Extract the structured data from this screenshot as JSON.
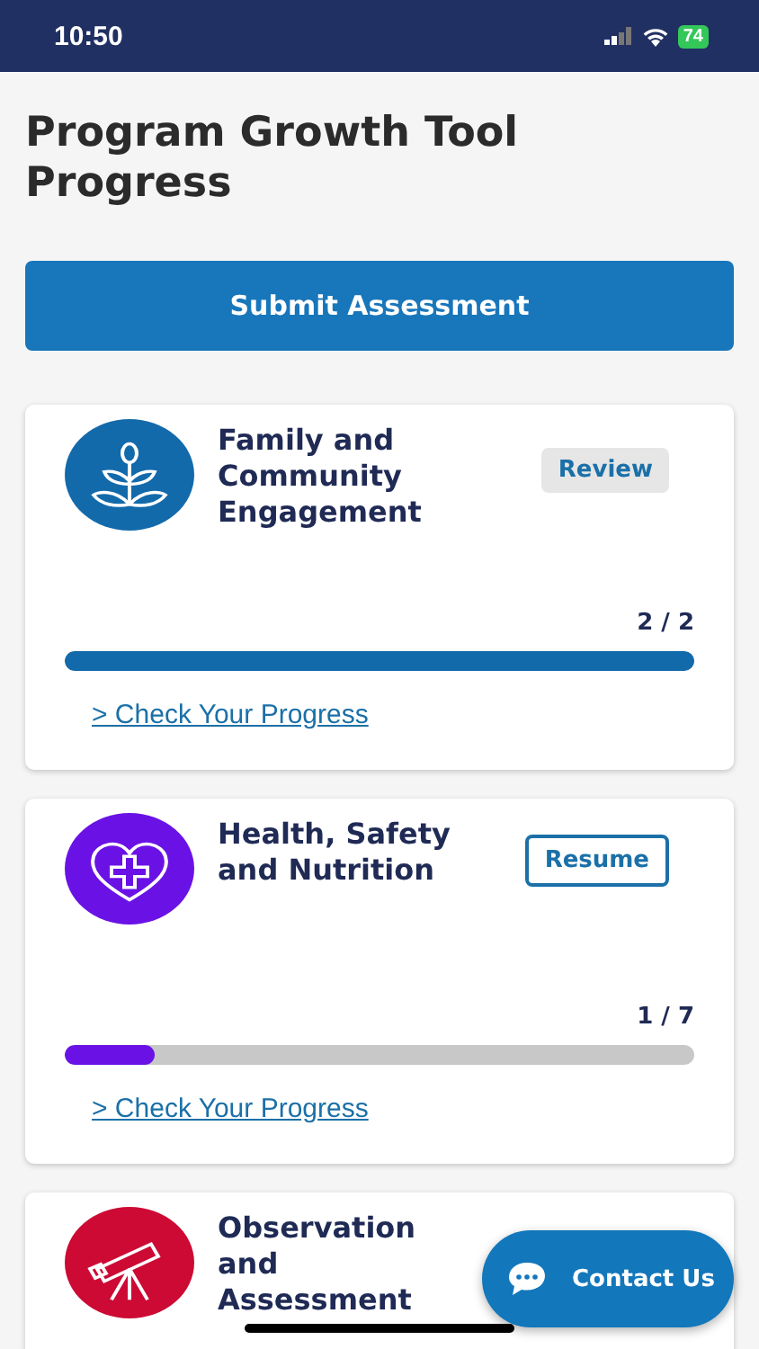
{
  "status_bar": {
    "time": "10:50",
    "battery": "74"
  },
  "title": "Program Growth Tool Progress",
  "submit_button": "Submit Assessment",
  "domains": [
    {
      "kind": "plant",
      "color": "#136aab",
      "title": "Family and Community Engagement",
      "action": {
        "kind": "review",
        "label": "Review"
      },
      "count": "2 / 2",
      "level": 1,
      "link": "> Check Your Progress"
    },
    {
      "kind": "heart",
      "color": "#6a12e6",
      "title": "Health, Safety and Nutrition",
      "action": {
        "kind": "resume",
        "label": "Resume"
      },
      "count": "1 / 7",
      "level": 0.142,
      "link": "> Check Your Progress"
    },
    {
      "kind": "telescope",
      "color": "#cc0a34",
      "title": "Observation and Assessment"
    }
  ],
  "contact_button": "Contact Us"
}
